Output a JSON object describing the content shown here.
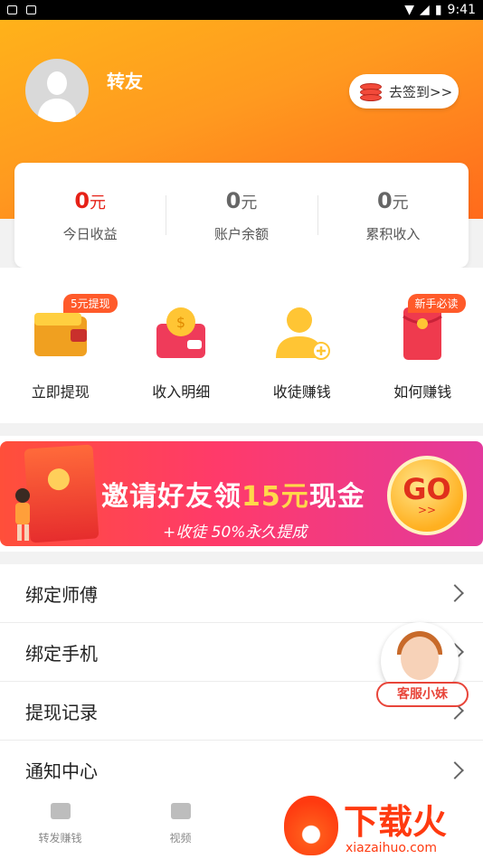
{
  "status_bar": {
    "time": "9:41"
  },
  "profile": {
    "name": "转友"
  },
  "checkin": {
    "label": "去签到>>"
  },
  "stats": [
    {
      "value": "0",
      "unit": "元",
      "label": "今日收益"
    },
    {
      "value": "0",
      "unit": "元",
      "label": "账户余额"
    },
    {
      "value": "0",
      "unit": "元",
      "label": "累积收入"
    }
  ],
  "actions": [
    {
      "label": "立即提现",
      "badge": "5元提现",
      "icon": "wallet-icon"
    },
    {
      "label": "收入明细",
      "badge": "",
      "icon": "coin-wallet-icon"
    },
    {
      "label": "收徒赚钱",
      "badge": "",
      "icon": "add-user-icon"
    },
    {
      "label": "如何赚钱",
      "badge": "新手必读",
      "icon": "red-envelope-icon"
    }
  ],
  "banner": {
    "title_prefix": "邀请好友领",
    "title_highlight": "15元",
    "title_suffix": "现金",
    "subtitle": "+收徒 50%永久提成",
    "go_label": "GO",
    "go_arrows": ">>"
  },
  "menu": [
    {
      "label": "绑定师傅"
    },
    {
      "label": "绑定手机"
    },
    {
      "label": "提现记录"
    },
    {
      "label": "通知中心"
    }
  ],
  "support": {
    "label": "客服小妹"
  },
  "tabs": [
    {
      "label": "转发赚钱",
      "icon": "news-icon"
    },
    {
      "label": "视频",
      "icon": "video-icon"
    }
  ],
  "watermark": {
    "text": "下载火",
    "sub": "xiazaihuo.com"
  },
  "colors": {
    "accent": "#ff9a1f",
    "red": "#e62117",
    "banner": "#ff3a6a"
  }
}
